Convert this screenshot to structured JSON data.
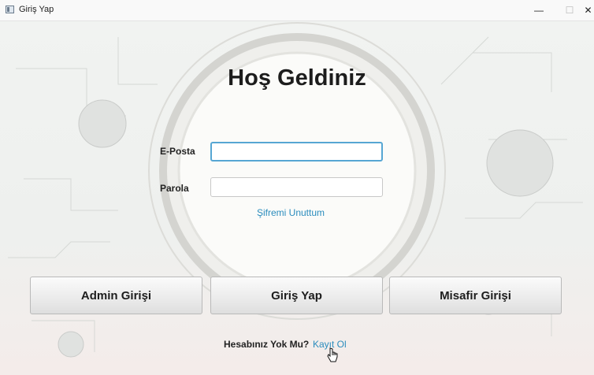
{
  "window": {
    "title": "Giriş Yap"
  },
  "controls": {
    "minimize": "—",
    "maximize": "☐",
    "close": "✕"
  },
  "login": {
    "heading": "Hoş Geldiniz",
    "email_label": "E-Posta",
    "email_value": "",
    "password_label": "Parola",
    "password_value": "",
    "forgot_password": "Şifremi Unuttum"
  },
  "buttons": {
    "admin_login": "Admin Girişi",
    "login": "Giriş Yap",
    "guest_login": "Misafir Girişi"
  },
  "footer": {
    "question": "Hesabınız Yok Mu?",
    "register_link": "Kayıt Ol"
  },
  "colors": {
    "link": "#2a8cbd",
    "focus_border": "#56a6d3"
  }
}
